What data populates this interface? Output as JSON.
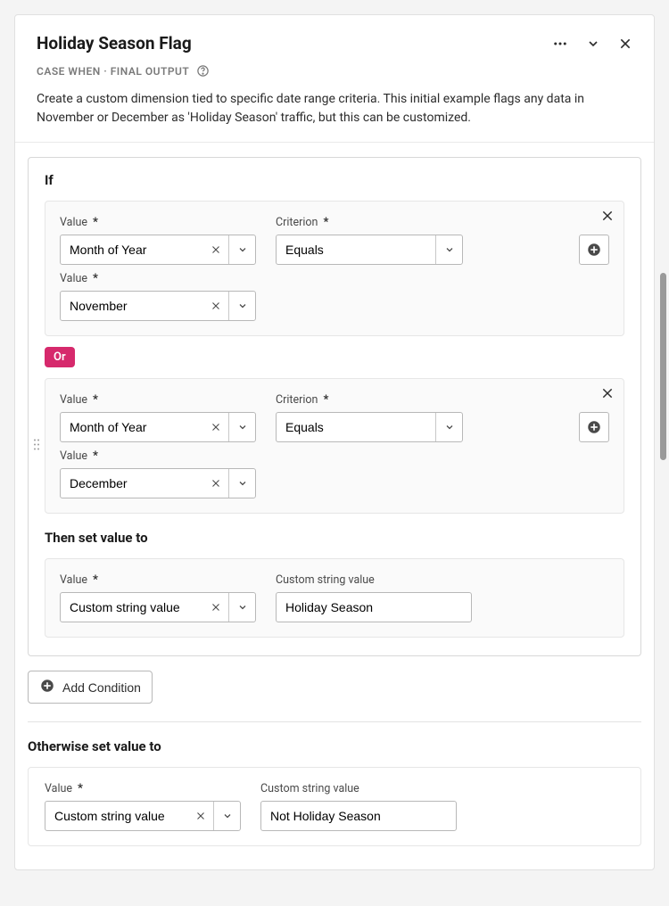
{
  "header": {
    "title": "Holiday Season Flag",
    "subtitle": "CASE WHEN · FINAL OUTPUT",
    "description": "Create a custom dimension tied to specific date range criteria. This initial example flags any data in November or December as 'Holiday Season' traffic, but this can be customized."
  },
  "labels": {
    "if": "If",
    "value": "Value",
    "criterion": "Criterion",
    "or": "Or",
    "then": "Then set value to",
    "custom_string": "Custom string value",
    "add_condition": "Add Condition",
    "otherwise": "Otherwise set value to"
  },
  "conditions": [
    {
      "value_field_1": "Month of Year",
      "criterion": "Equals",
      "value_field_2": "November"
    },
    {
      "value_field_1": "Month of Year",
      "criterion": "Equals",
      "value_field_2": "December"
    }
  ],
  "then": {
    "value_type": "Custom string value",
    "custom_string": "Holiday Season"
  },
  "otherwise": {
    "value_type": "Custom string value",
    "custom_string": "Not Holiday Season"
  }
}
